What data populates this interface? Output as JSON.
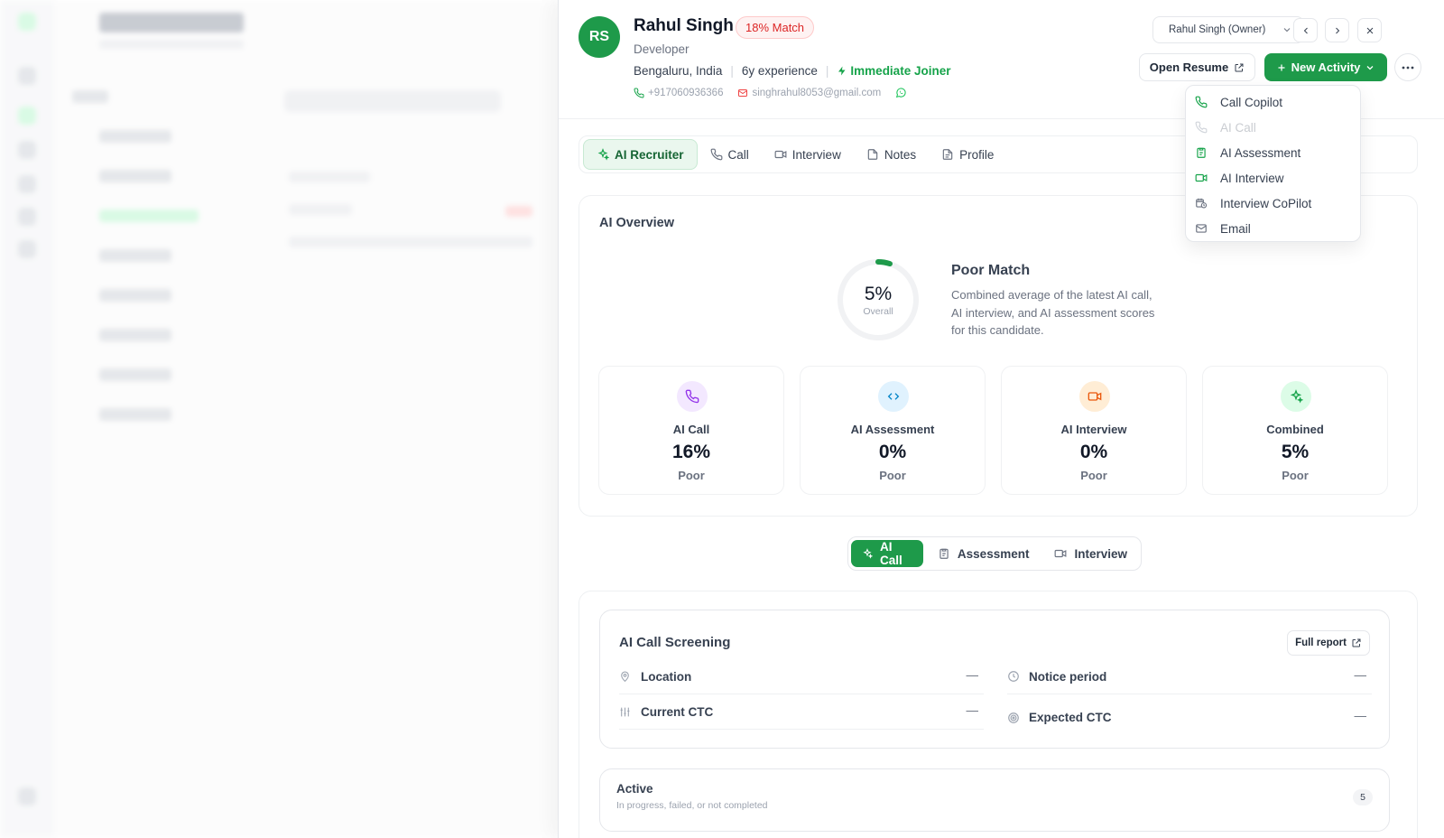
{
  "candidate": {
    "initials": "RS",
    "name": "Rahul Singh",
    "match": "18% Match",
    "role": "Developer",
    "location": "Bengaluru, India",
    "experience": "6y experience",
    "availability": "Immediate Joiner",
    "phone": "+917060936366",
    "email": "singhrahul8053@gmail.com"
  },
  "header": {
    "owner_select": "Rahul Singh (Owner)",
    "open_resume": "Open Resume",
    "new_activity": "New Activity"
  },
  "tabs": [
    {
      "label": "AI Recruiter",
      "active": true,
      "icon": "sparkles-icon"
    },
    {
      "label": "Call",
      "icon": "phone-icon"
    },
    {
      "label": "Interview",
      "icon": "video-icon"
    },
    {
      "label": "Notes",
      "icon": "file-icon"
    },
    {
      "label": "Profile",
      "icon": "file-text-icon"
    }
  ],
  "overview": {
    "title": "AI Overview",
    "overall_pct": "5%",
    "overall_value": 5,
    "overall_label": "Overall",
    "verdict": "Poor Match",
    "description": "Combined average of the latest AI call, AI interview, and AI assessment scores for this candidate.",
    "scores": [
      {
        "label": "AI Call",
        "value": "16%",
        "status": "Poor",
        "icon": "phone-icon"
      },
      {
        "label": "AI Assessment",
        "value": "0%",
        "status": "Poor",
        "icon": "code-icon"
      },
      {
        "label": "AI Interview",
        "value": "0%",
        "status": "Poor",
        "icon": "video-icon"
      },
      {
        "label": "Combined",
        "value": "5%",
        "status": "Poor",
        "icon": "sparkles-icon"
      }
    ]
  },
  "subtabs": [
    {
      "label": "AI Call",
      "active": true
    },
    {
      "label": "Assessment"
    },
    {
      "label": "Interview"
    }
  ],
  "screening": {
    "title": "AI Call Screening",
    "full_report": "Full report",
    "fields": [
      {
        "label": "Location",
        "value": "—"
      },
      {
        "label": "Notice period",
        "value": "—"
      },
      {
        "label": "Current CTC",
        "value": "—"
      },
      {
        "label": "Expected CTC",
        "value": "—"
      }
    ]
  },
  "active": {
    "title": "Active",
    "subtitle": "In progress, failed, or not completed",
    "count": "5"
  },
  "menu": [
    {
      "label": "Call Copilot",
      "icon": "phone-icon"
    },
    {
      "label": "AI Call",
      "icon": "phone-icon",
      "disabled": true
    },
    {
      "label": "AI Assessment",
      "icon": "clipboard-icon"
    },
    {
      "label": "AI Interview",
      "icon": "video-icon"
    },
    {
      "label": "Interview CoPilot",
      "icon": "calendar-clock-icon"
    },
    {
      "label": "Email",
      "icon": "mail-icon"
    }
  ],
  "colors": {
    "brand_green": "#1e9a4a",
    "match_red": "#dc2626"
  }
}
